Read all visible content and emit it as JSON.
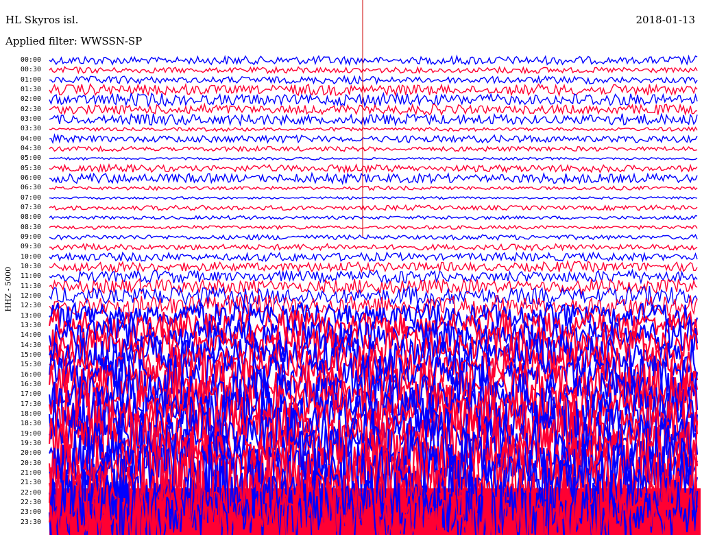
{
  "header": {
    "station": "HL Skyros isl.",
    "date": "2018-01-13",
    "filter": "Applied filter: WWSSN-SP"
  },
  "chart_data": {
    "type": "line",
    "title": "HL Skyros isl.",
    "ylabel": "HHZ - 5000",
    "xlabel": "",
    "y_ticks": [
      "00:00",
      "00:30",
      "01:00",
      "01:30",
      "02:00",
      "02:30",
      "03:00",
      "03:30",
      "04:00",
      "04:30",
      "05:00",
      "05:30",
      "06:00",
      "06:30",
      "07:00",
      "07:30",
      "08:00",
      "08:30",
      "09:00",
      "09:30",
      "10:00",
      "10:30",
      "11:00",
      "11:30",
      "12:00",
      "12:30",
      "13:00",
      "13:30",
      "14:00",
      "14:30",
      "15:00",
      "15:30",
      "16:00",
      "16:30",
      "17:00",
      "17:30",
      "18:00",
      "18:30",
      "19:00",
      "19:30",
      "20:00",
      "20:30",
      "21:00",
      "21:30",
      "22:00",
      "22:30",
      "23:00",
      "23:30"
    ],
    "series_colors": [
      "#0000ff",
      "#ff0033"
    ],
    "trace_amplitude": [
      7,
      5,
      6,
      9,
      10,
      8,
      9,
      3,
      6,
      4,
      2,
      6,
      8,
      3,
      2,
      4,
      3,
      3,
      4,
      5,
      7,
      8,
      10,
      12,
      15,
      18,
      22,
      25,
      28,
      30,
      32,
      34,
      36,
      38,
      40,
      42,
      44,
      46,
      48,
      50,
      52,
      54,
      56,
      58,
      60,
      60,
      60,
      60
    ],
    "marker_color": "#cc0000"
  }
}
